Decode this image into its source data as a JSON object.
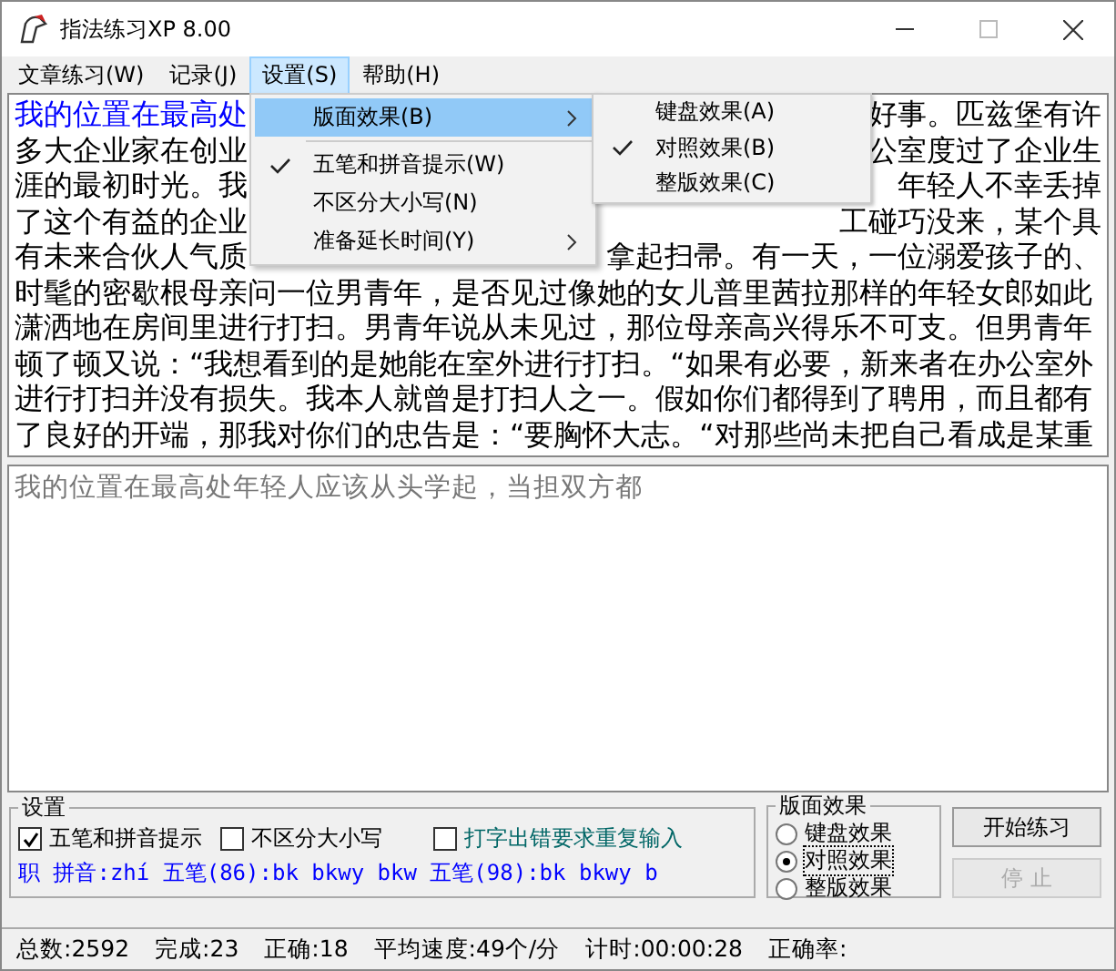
{
  "window": {
    "title": "指法练习XP 8.00"
  },
  "menu_bar": [
    {
      "label": "文章练习(W)",
      "selected": false
    },
    {
      "label": "记录(J)",
      "selected": false
    },
    {
      "label": "设置(S)",
      "selected": true
    },
    {
      "label": "帮助(H)",
      "selected": false
    }
  ],
  "dropdown": {
    "items": [
      {
        "label": "版面效果(B)",
        "checked": false,
        "submenu": true,
        "selected": true
      },
      {
        "label": "五笔和拼音提示(W)",
        "checked": true,
        "submenu": false,
        "selected": false
      },
      {
        "label": "不区分大小写(N)",
        "checked": false,
        "submenu": false,
        "selected": false
      },
      {
        "label": "准备延长时间(Y)",
        "checked": false,
        "submenu": true,
        "selected": false
      }
    ],
    "submenu": [
      {
        "label": "键盘效果(A)",
        "checked": false
      },
      {
        "label": "对照效果(B)",
        "checked": true
      },
      {
        "label": "整版效果(C)",
        "checked": false
      }
    ]
  },
  "article": {
    "lines": [
      {
        "typed": "我的位置在最高处",
        "end": "好事。匹兹堡有许"
      },
      {
        "start": "多大企业家在创业",
        "end": "公室度过了企业生"
      },
      {
        "start": "涯的最初时光。我",
        "end": "年轻人不幸丢掉"
      },
      {
        "start": "了这个有益的企业",
        "end": "工碰巧没来，某个具"
      },
      {
        "start": "有未来合伙人气质",
        "end": "拿起扫帚。有一天，一位溺爱孩子的、"
      },
      {
        "text": "时髦的密歇根母亲问一位男青年，是否见过像她的女儿普里茜拉那样的年轻女郎如此"
      },
      {
        "text": "潇洒地在房间里进行打扫。男青年说从未见过，那位母亲高兴得乐不可支。但男青年"
      },
      {
        "text": "顿了顿又说：“我想看到的是她能在室外进行打扫。“如果有必要，新来者在办公室外"
      },
      {
        "text": "进行打扫并没有损失。我本人就曾是打扫人之一。假如你们都得到了聘用，而且都有"
      },
      {
        "text": "了良好的开端，那我对你们的忠告是：“要胸怀大志。“对那些尚未把自己看成是某重"
      }
    ]
  },
  "input": {
    "value": "我的位置在最高处年轻人应该从头学起，当担双方都"
  },
  "settings": {
    "title": "设置",
    "options": [
      {
        "label": "五笔和拼音提示",
        "checked": true
      },
      {
        "label": "不区分大小写",
        "checked": false
      },
      {
        "label": "打字出错要求重复输入",
        "checked": false
      }
    ],
    "hint": "职 拼音:zhí 五笔(86):bk bkwy bkw 五笔(98):bk bkwy b"
  },
  "layout_effect": {
    "title": "版面效果",
    "options": [
      {
        "label": "键盘效果",
        "selected": false
      },
      {
        "label": "对照效果",
        "selected": true
      },
      {
        "label": "整版效果",
        "selected": false
      }
    ]
  },
  "buttons": [
    {
      "label": "开始练习",
      "disabled": false
    },
    {
      "label": "停 止",
      "disabled": true
    }
  ],
  "status_bar": [
    "总数:2592",
    "完成:23",
    "正确:18",
    "平均速度:49个/分",
    "计时:00:00:28",
    "正确率:"
  ]
}
